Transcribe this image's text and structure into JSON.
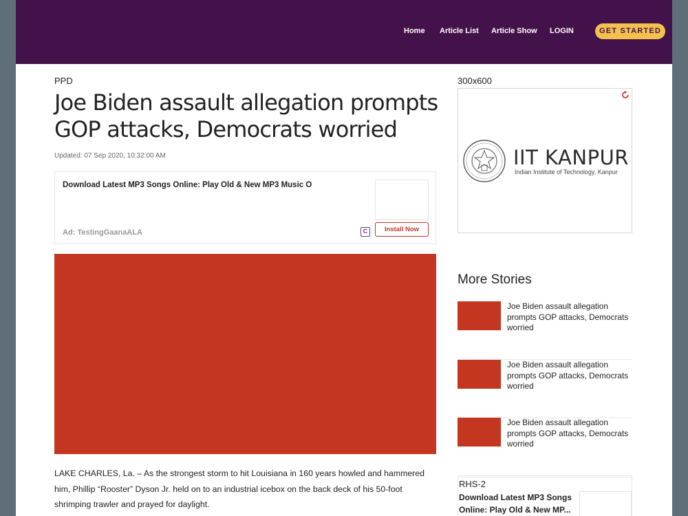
{
  "nav": {
    "items": [
      "Home",
      "Article List",
      "Article Show",
      "LOGIN"
    ],
    "cta": "GET STARTED"
  },
  "article": {
    "section": "PPD",
    "headline": "Joe Biden assault allegation prompts GOP attacks, Democrats worried",
    "updated": "Updated: 07 Sep 2020, 10:32:00 AM",
    "body": "LAKE CHARLES, La. – As the strongest storm to hit Louisiana in 160 years howled and hammered him, Phillip “Rooster” Dyson Jr. held on to an industrial icebox on the back deck of his 50-foot shrimping trawler and prayed for daylight."
  },
  "ad": {
    "title": "Download Latest MP3 Songs Online: Play Old & New MP3 Music O",
    "sponsor": "Ad: TestingGaanaALA",
    "install": "Install Now",
    "badge": "C"
  },
  "rail": {
    "ad_label": "300x600",
    "logo_title": "IIT KANPUR",
    "logo_subtitle": "Indian Institute of Technology, Kanpur",
    "more_title": "More Stories",
    "stories": [
      "Joe Biden assault allegation prompts GOP attacks, Democrats worried",
      "Joe Biden assault allegation prompts GOP attacks, Democrats worried",
      "Joe Biden assault allegation prompts GOP attacks, Democrats worried"
    ],
    "rhs2_label": "RHS-2",
    "rhs2_text": "Download Latest MP3 Songs Online: Play Old & New MP..."
  },
  "colors": {
    "header_bg": "#44124a",
    "cta_bg": "#f2c14e",
    "image_placeholder": "#c4361f",
    "install_border": "#c0392b"
  }
}
